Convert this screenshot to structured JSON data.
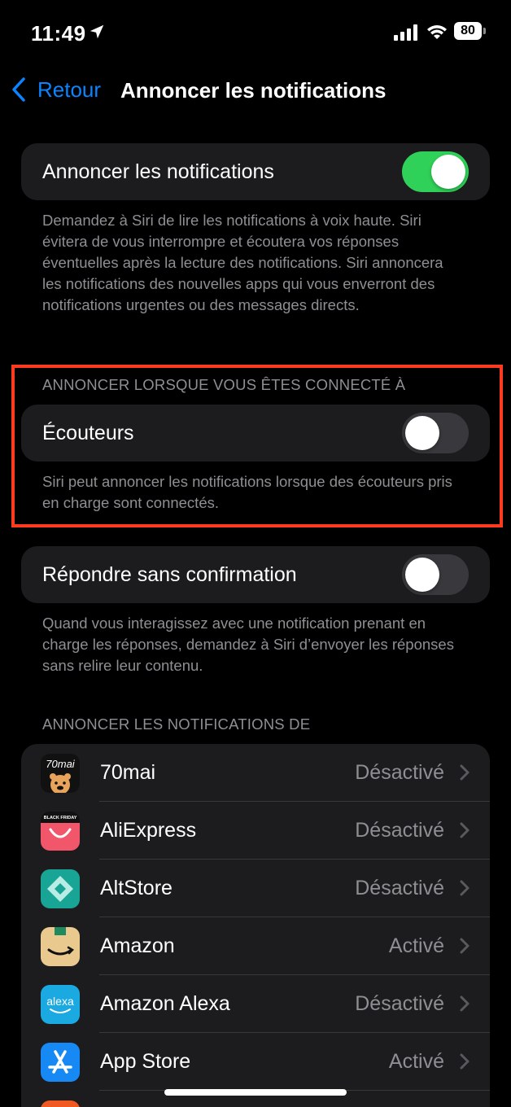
{
  "status": {
    "time": "11:49",
    "battery": "80"
  },
  "nav": {
    "back_label": "Retour",
    "title": "Annoncer les notifications"
  },
  "announce": {
    "label": "Annoncer les notifications",
    "enabled": true,
    "footer": "Demandez à Siri de lire les notifications à voix haute. Siri évitera de vous interrompre et écoutera vos réponses éventuelles après la lecture des notifications. Siri annoncera les notifications des nouvelles apps qui vous enverront des notifications urgentes ou des messages directs."
  },
  "connected": {
    "header": "ANNONCER LORSQUE VOUS ÊTES CONNECTÉ À",
    "label": "Écouteurs",
    "enabled": false,
    "footer": "Siri peut annoncer les notifications lorsque des écouteurs pris en charge sont connectés."
  },
  "reply": {
    "label": "Répondre sans confirmation",
    "enabled": false,
    "footer": "Quand vous interagissez avec une notification prenant en charge les réponses, demandez à Siri d’envoyer les réponses sans relire leur contenu."
  },
  "apps": {
    "header": "ANNONCER LES NOTIFICATIONS DE",
    "items": [
      {
        "name": "70mai",
        "value": "Désactivé",
        "icon": "70mai-app-icon",
        "icon_text": "70mai"
      },
      {
        "name": "AliExpress",
        "value": "Désactivé",
        "icon": "aliexpress-app-icon",
        "icon_text": "BLACK FRIDAY"
      },
      {
        "name": "AltStore",
        "value": "Désactivé",
        "icon": "altstore-app-icon"
      },
      {
        "name": "Amazon",
        "value": "Activé",
        "icon": "amazon-app-icon"
      },
      {
        "name": "Amazon Alexa",
        "value": "Désactivé",
        "icon": "alexa-app-icon",
        "icon_text": "alexa"
      },
      {
        "name": "App Store",
        "value": "Activé",
        "icon": "app-store-icon"
      }
    ]
  },
  "colors": {
    "accent": "#0a84ff",
    "toggle_on": "#30d158",
    "highlight_box": "#ff3b1f"
  }
}
